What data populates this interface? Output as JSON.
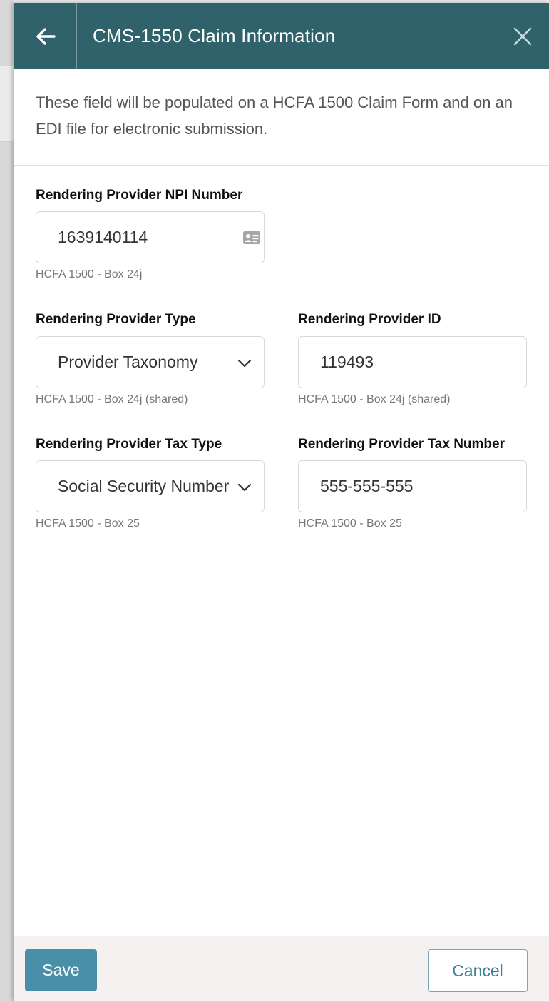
{
  "header": {
    "title": "CMS-1550 Claim Information",
    "back_icon": "arrow-left-icon",
    "close_icon": "close-icon",
    "background_color": "#2f626b"
  },
  "intro_text": "These field will be populated on a HCFA 1500 Claim Form and on an EDI file for electronic submission.",
  "fields": {
    "npi": {
      "label": "Rendering Provider NPI Number",
      "value": "1639140114",
      "hint": "HCFA 1500 - Box 24j",
      "icon": "id-card-icon"
    },
    "provider_type": {
      "label": "Rendering Provider Type",
      "value": "Provider Taxonomy",
      "hint": "HCFA 1500 - Box 24j (shared)"
    },
    "provider_id": {
      "label": "Rendering Provider ID",
      "value": "119493",
      "hint": "HCFA 1500 - Box 24j (shared)"
    },
    "tax_type": {
      "label": "Rendering Provider Tax Type",
      "value": "Social Security Number",
      "hint": "HCFA 1500 - Box 25"
    },
    "tax_number": {
      "label": "Rendering Provider Tax Number",
      "value": "555-555-555",
      "hint": "HCFA 1500 - Box 25"
    }
  },
  "footer": {
    "save_label": "Save",
    "cancel_label": "Cancel",
    "accent_color": "#4a8fa8"
  }
}
